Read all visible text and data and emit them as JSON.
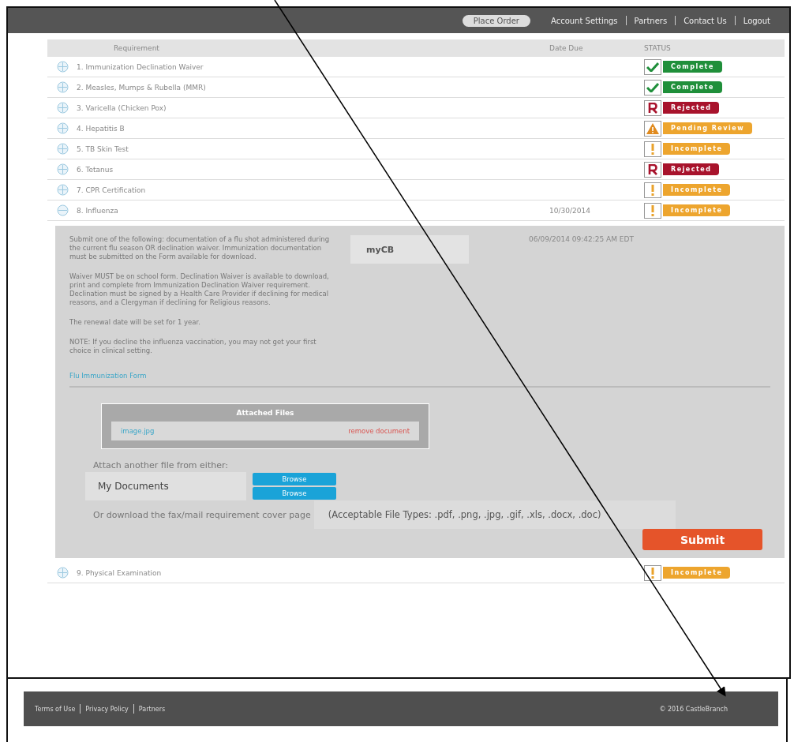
{
  "header": {
    "nav": [
      {
        "label": "Place Order",
        "kind": "pill"
      },
      {
        "label": "Account Settings",
        "kind": "link"
      },
      {
        "label": "Partners",
        "kind": "link"
      },
      {
        "label": "Contact Us",
        "kind": "link"
      },
      {
        "label": "Logout",
        "kind": "link"
      }
    ]
  },
  "table": {
    "columns": [
      "Requirement",
      "Date Due",
      "STATUS"
    ],
    "rows": [
      {
        "name": "1. Immunization Declination Waiver",
        "date_due": "",
        "expanded": false,
        "status": {
          "kind": "complete",
          "label": "Complete"
        }
      },
      {
        "name": "2. Measles, Mumps & Rubella (MMR)",
        "date_due": "",
        "expanded": false,
        "status": {
          "kind": "complete",
          "label": "Complete"
        }
      },
      {
        "name": "3. Varicella (Chicken Pox)",
        "date_due": "",
        "expanded": false,
        "status": {
          "kind": "rejected",
          "label": "Rejected"
        }
      },
      {
        "name": "4. Hepatitis B",
        "date_due": "",
        "expanded": false,
        "status": {
          "kind": "pending",
          "label": "Pending Review"
        }
      },
      {
        "name": "5. TB Skin Test",
        "date_due": "",
        "expanded": false,
        "status": {
          "kind": "incomplete",
          "label": "Incomplete"
        }
      },
      {
        "name": "6. Tetanus",
        "date_due": "",
        "expanded": false,
        "status": {
          "kind": "rejected",
          "label": "Rejected"
        }
      },
      {
        "name": "7. CPR Certification",
        "date_due": "",
        "expanded": false,
        "status": {
          "kind": "incomplete",
          "label": "Incomplete"
        }
      },
      {
        "name": "8. Influenza",
        "date_due": "10/30/2014",
        "expanded": true,
        "status": {
          "kind": "incomplete",
          "label": "Incomplete"
        }
      },
      {
        "name": "9. Physical Examination",
        "date_due": "",
        "expanded": false,
        "status": {
          "kind": "incomplete",
          "label": "Incomplete"
        }
      }
    ]
  },
  "detail": {
    "paragraphs": [
      "Submit one of the following: documentation of a flu shot administered during the current flu season OR declination waiver.  Immunization documentation must be submitted on the Form available for download.",
      "Waiver MUST be on school form. Declination Waiver is available to download, print and complete from Immunization Declination Waiver requirement. Declination must be signed by a Health Care Provider if declining for medical reasons, and a Clergyman if declining for Religious reasons.",
      "The renewal date will be set for 1 year.",
      "NOTE: If you decline the influenza vaccination, you may not get your first choice in clinical setting."
    ],
    "form_link": "Flu Immunization Form",
    "reviewer": "myCB",
    "timestamp": "06/09/2014 09:42:25 AM EDT",
    "attached_files": {
      "title": "Attached Files",
      "files": [
        {
          "name": "image.jpg",
          "action": "remove document"
        }
      ]
    },
    "attach_label": "Attach another file from either:",
    "source": "My Documents",
    "browse_buttons": [
      "Browse",
      "Browse"
    ],
    "download_label": "Or download the fax/mail requirement cover page",
    "file_types": "(Acceptable File Types: .pdf, .png, .jpg, .gif, .xls, .docx, .doc)",
    "submit": "Submit"
  },
  "footer": {
    "links": [
      "Terms of Use",
      "Privacy Policy",
      "Partners"
    ],
    "copyright": "© 2016 CastleBranch"
  }
}
